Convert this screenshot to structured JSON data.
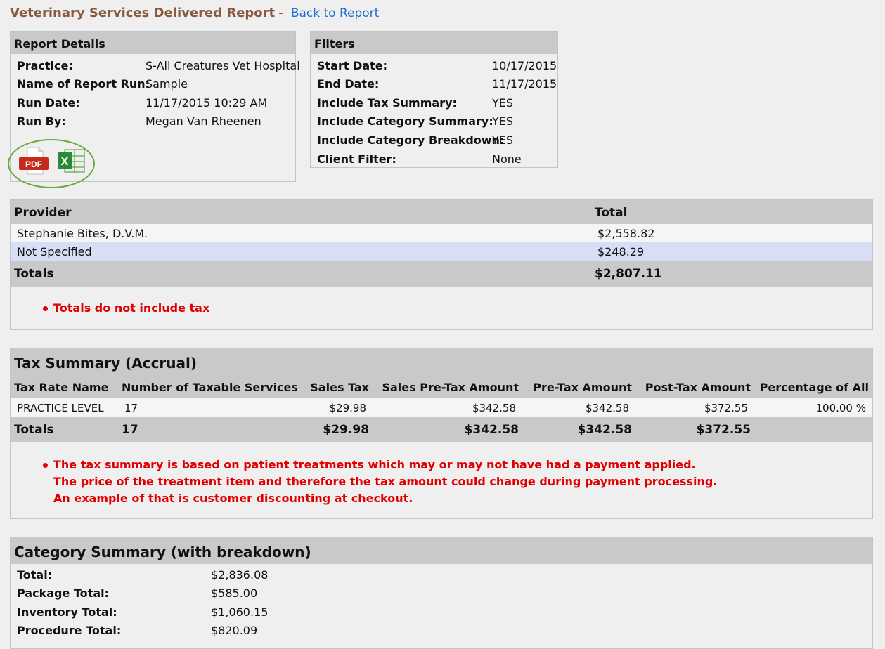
{
  "header": {
    "title": "Veterinary Services Delivered Report",
    "separator": "-",
    "back_link": "Back to Report"
  },
  "report_details": {
    "heading": "Report Details",
    "rows": [
      {
        "label": "Practice:",
        "value": "S-All Creatures Vet Hospital"
      },
      {
        "label": "Name of Report Run:",
        "value": "Sample"
      },
      {
        "label": "Run Date:",
        "value": "11/17/2015 10:29 AM"
      },
      {
        "label": "Run By:",
        "value": "Megan Van Rheenen"
      }
    ],
    "export_icons": [
      "pdf-icon",
      "excel-icon"
    ],
    "pdf_label": "PDF",
    "excel_label": "X"
  },
  "filters": {
    "heading": "Filters",
    "rows": [
      {
        "label": "Start Date:",
        "value": "10/17/2015"
      },
      {
        "label": "End Date:",
        "value": "11/17/2015"
      },
      {
        "label": "Include Tax Summary:",
        "value": "YES"
      },
      {
        "label": "Include Category Summary:",
        "value": "YES"
      },
      {
        "label": "Include Category Breakdown:",
        "value": "YES"
      },
      {
        "label": "Client Filter:",
        "value": "None"
      }
    ]
  },
  "provider_table": {
    "headers": {
      "provider": "Provider",
      "total": "Total"
    },
    "rows": [
      {
        "provider": "Stephanie Bites, D.V.M.",
        "total": "$2,558.82"
      },
      {
        "provider": "Not Specified",
        "total": "$248.29"
      }
    ],
    "totals": {
      "label": "Totals",
      "value": "$2,807.11"
    },
    "note": "Totals do not include tax"
  },
  "tax_summary": {
    "heading": "Tax Summary (Accrual)",
    "headers": [
      "Tax Rate Name",
      "Number of Taxable Services",
      "Sales Tax",
      "Sales Pre-Tax Amount",
      "Pre-Tax Amount",
      "Post-Tax Amount",
      "Percentage of All"
    ],
    "row": [
      "PRACTICE LEVEL",
      "17",
      "$29.98",
      "$342.58",
      "$342.58",
      "$372.55",
      "100.00 %"
    ],
    "totals": [
      "Totals",
      "17",
      "$29.98",
      "$342.58",
      "$342.58",
      "$372.55",
      ""
    ],
    "notes": [
      "The tax summary is based on patient treatments which may or may not have had a payment applied.",
      "The price of the treatment item and therefore the tax amount could change during payment processing.",
      "An example of that is customer discounting at checkout."
    ]
  },
  "category_summary": {
    "heading": "Category Summary (with breakdown)",
    "rows": [
      {
        "label": "Total:",
        "value": "$2,836.08"
      },
      {
        "label": "Package Total:",
        "value": "$585.00"
      },
      {
        "label": "Inventory Total:",
        "value": "$1,060.15"
      },
      {
        "label": "Procedure Total:",
        "value": "$820.09"
      }
    ]
  },
  "colors": {
    "title": "#8a5a3e",
    "link": "#1f6fd1",
    "alert": "#e00000",
    "highlight_row": "#d9def7",
    "header_bg": "#c9c9c9",
    "icon_circle": "#6aaa3a"
  }
}
